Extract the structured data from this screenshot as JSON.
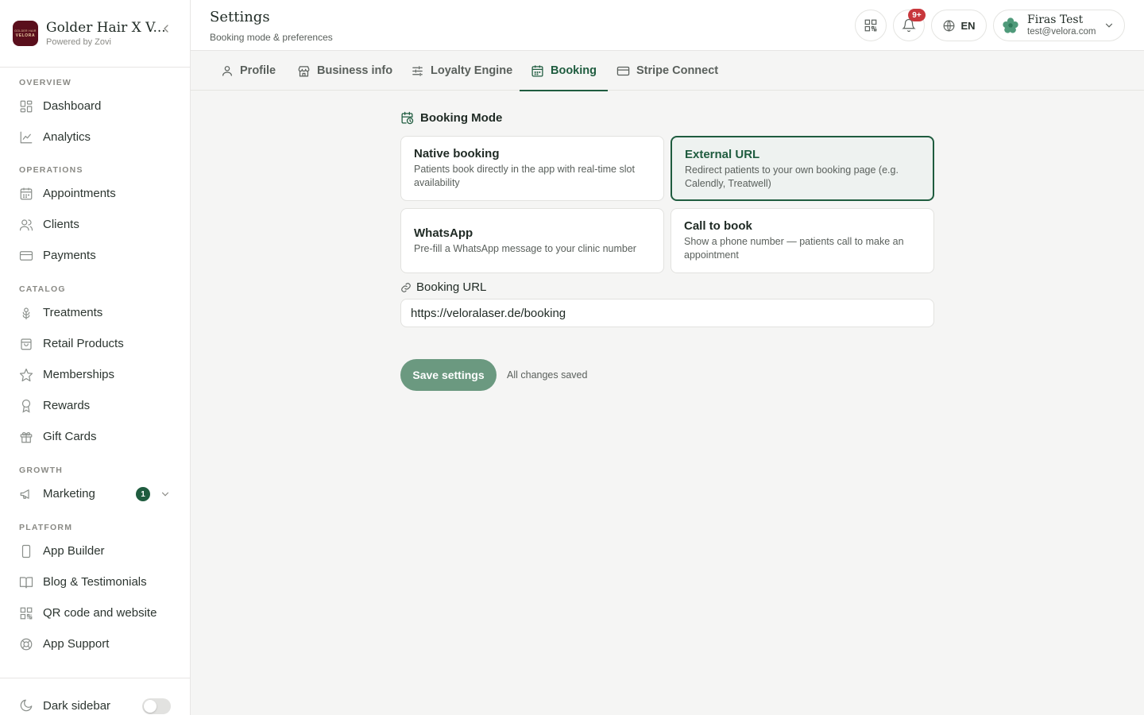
{
  "brand": {
    "logo_top": "GOLDER HAIR",
    "logo_bottom": "VELORA",
    "title": "Golder Hair X V...",
    "subtitle": "Powered by Zovi"
  },
  "sidebar": {
    "sections": [
      {
        "label": "OVERVIEW",
        "items": [
          {
            "label": "Dashboard",
            "icon": "dashboard-icon"
          },
          {
            "label": "Analytics",
            "icon": "analytics-icon"
          }
        ]
      },
      {
        "label": "OPERATIONS",
        "items": [
          {
            "label": "Appointments",
            "icon": "calendar-icon"
          },
          {
            "label": "Clients",
            "icon": "users-icon"
          },
          {
            "label": "Payments",
            "icon": "credit-card-icon"
          }
        ]
      },
      {
        "label": "CATALOG",
        "items": [
          {
            "label": "Treatments",
            "icon": "flower-icon"
          },
          {
            "label": "Retail Products",
            "icon": "shopping-bag-icon"
          },
          {
            "label": "Memberships",
            "icon": "star-icon"
          },
          {
            "label": "Rewards",
            "icon": "award-icon"
          },
          {
            "label": "Gift Cards",
            "icon": "gift-icon"
          }
        ]
      },
      {
        "label": "GROWTH",
        "items": [
          {
            "label": "Marketing",
            "icon": "megaphone-icon",
            "badge": "1"
          }
        ]
      },
      {
        "label": "PLATFORM",
        "items": [
          {
            "label": "App Builder",
            "icon": "smartphone-icon"
          },
          {
            "label": "Blog & Testimonials",
            "icon": "book-icon"
          },
          {
            "label": "QR code and website",
            "icon": "qr-code-icon"
          },
          {
            "label": "App Support",
            "icon": "life-buoy-icon"
          }
        ]
      }
    ],
    "footer": {
      "dark_sidebar_label": "Dark sidebar",
      "dark_sidebar_on": false
    }
  },
  "header": {
    "title": "Settings",
    "subtitle": "Booking mode & preferences",
    "notification_count": "9+",
    "language": "EN",
    "user": {
      "name": "Firas Test",
      "email": "test@velora.com"
    }
  },
  "tabs": [
    {
      "label": "Profile",
      "icon": "user-icon"
    },
    {
      "label": "Business info",
      "icon": "store-icon"
    },
    {
      "label": "Loyalty Engine",
      "icon": "sliders-icon"
    },
    {
      "label": "Booking",
      "icon": "calendar-icon",
      "active": true
    },
    {
      "label": "Stripe Connect",
      "icon": "credit-card-icon"
    }
  ],
  "booking": {
    "mode_title": "Booking Mode",
    "options": [
      {
        "title": "Native booking",
        "description": "Patients book directly in the app with real-time slot availability",
        "selected": false
      },
      {
        "title": "External URL",
        "description": "Redirect patients to your own booking page (e.g. Calendly, Treatwell)",
        "selected": true
      },
      {
        "title": "WhatsApp",
        "description": "Pre-fill a WhatsApp message to your clinic number",
        "selected": false
      },
      {
        "title": "Call to book",
        "description": "Show a phone number — patients call to make an appointment",
        "selected": false
      }
    ],
    "url_label": "Booking URL",
    "url_value": "https://veloralaser.de/booking",
    "save_label": "Save settings",
    "status": "All changes saved"
  },
  "colors": {
    "accent": "#1f5c3f",
    "save_button": "#6b9980",
    "notification": "#c8373c",
    "brand_logo": "#5a0f1c"
  }
}
